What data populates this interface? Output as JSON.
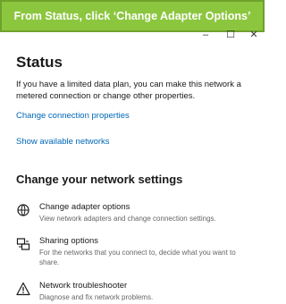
{
  "banner": {
    "text": "From Status, click ‘Change Adapter Options’"
  },
  "window": {
    "minimize": "–",
    "maximize": "☐",
    "close": "✕"
  },
  "status": {
    "title": "Status",
    "description": "If you have a limited data plan, you can make this network a metered connection or change other properties.",
    "change_connection_properties": "Change connection properties",
    "show_available_networks": "Show available networks"
  },
  "settings": {
    "heading": "Change your network settings",
    "items": [
      {
        "icon": "adapter-icon",
        "name": "Change adapter options",
        "desc": "View network adapters and change connection settings."
      },
      {
        "icon": "sharing-icon",
        "name": "Sharing options",
        "desc": "For the networks that you connect to, decide what you want to share."
      },
      {
        "icon": "warning-icon",
        "name": "Network troubleshooter",
        "desc": "Diagnose and fix network problems."
      }
    ]
  },
  "colors": {
    "banner_bg": "#8cc63f",
    "link": "#0067b8"
  }
}
